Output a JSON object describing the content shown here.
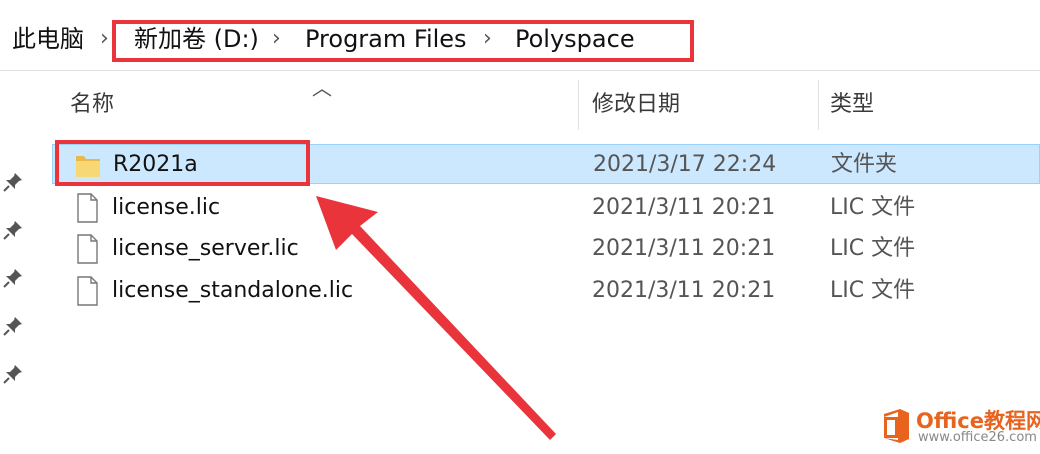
{
  "breadcrumb": {
    "items": [
      "此电脑",
      "新加卷 (D:)",
      "Program Files",
      "Polyspace"
    ],
    "separator": "›"
  },
  "columns": {
    "name": "名称",
    "date": "修改日期",
    "type": "类型"
  },
  "files": [
    {
      "name": "R2021a",
      "date": "2021/3/17 22:24",
      "type": "文件夹",
      "icon": "folder-icon",
      "selected": true
    },
    {
      "name": "license.lic",
      "date": "2021/3/11 20:21",
      "type": "LIC 文件",
      "icon": "file-icon",
      "selected": false
    },
    {
      "name": "license_server.lic",
      "date": "2021/3/11 20:21",
      "type": "LIC 文件",
      "icon": "file-icon",
      "selected": false
    },
    {
      "name": "license_standalone.lic",
      "date": "2021/3/11 20:21",
      "type": "LIC 文件",
      "icon": "file-icon",
      "selected": false
    }
  ],
  "watermark": {
    "brand": "Office教程网",
    "url": "www.office26.com"
  },
  "colors": {
    "highlight": "#e8343a",
    "selection": "#cce8ff",
    "folder": "#f8d775",
    "watermark": "#e8641e"
  }
}
